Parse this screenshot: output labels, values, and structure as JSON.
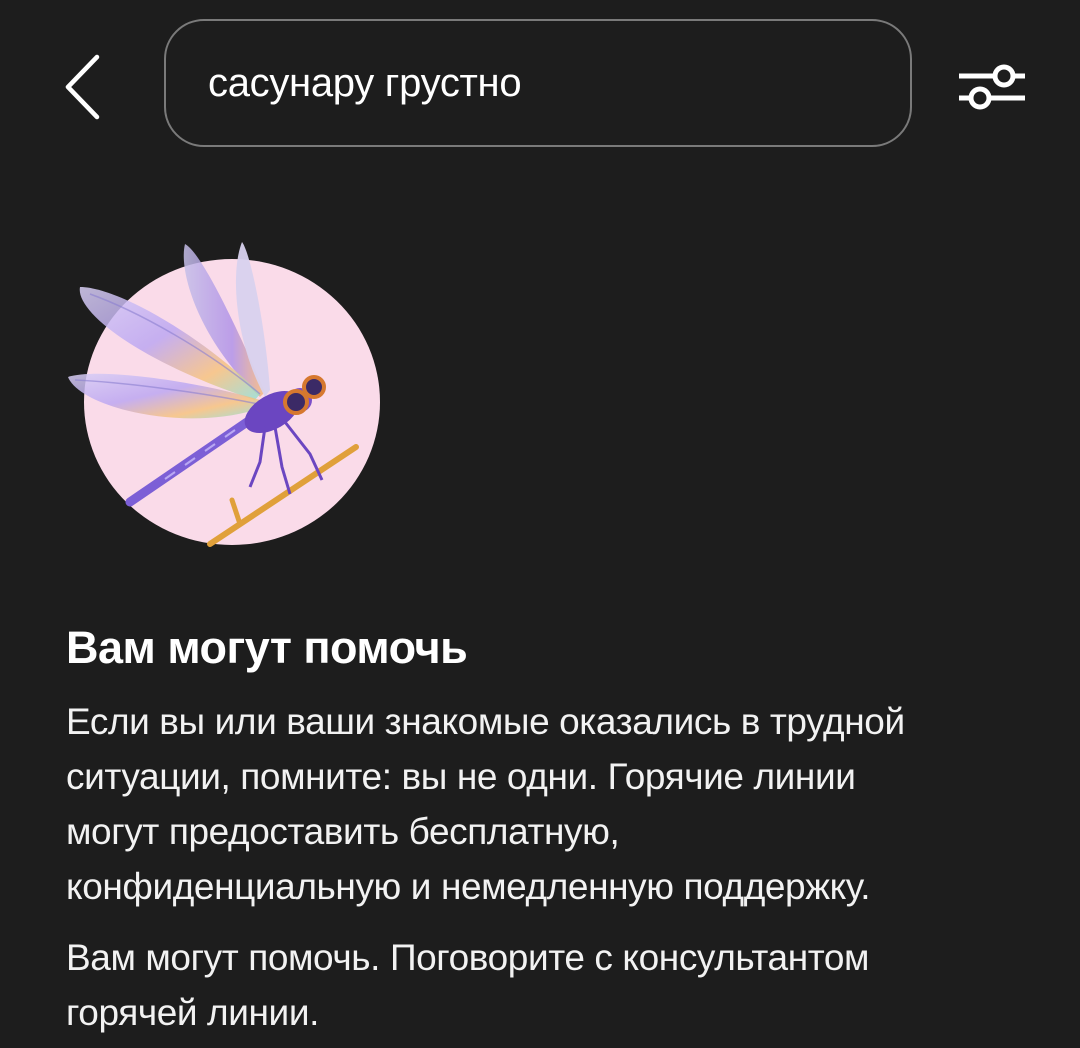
{
  "header": {
    "back_icon": "chevron-left-icon",
    "search": {
      "value": "сасунару грустно"
    },
    "filter_icon": "sliders-icon"
  },
  "illustration": {
    "icon": "dragonfly-illustration",
    "colors": {
      "circle": "#fadbe9",
      "body": "#6b46c1",
      "branch": "#e0a03a"
    }
  },
  "help": {
    "title": "Вам могут помочь",
    "paragraph1_lines": [
      "Если вы или ваши знакомые оказались в трудной",
      "ситуации, помните: вы не одни. Горячие линии",
      "могут предоставить бесплатную,",
      "конфиденциальную и немедленную поддержку."
    ],
    "paragraph2_lines": [
      "Вам могут помочь. Поговорите с консультантом",
      "горячей линии."
    ]
  },
  "colors": {
    "background": "#1d1d1d",
    "text": "#ffffff",
    "search_border": "#7a7a7a"
  }
}
